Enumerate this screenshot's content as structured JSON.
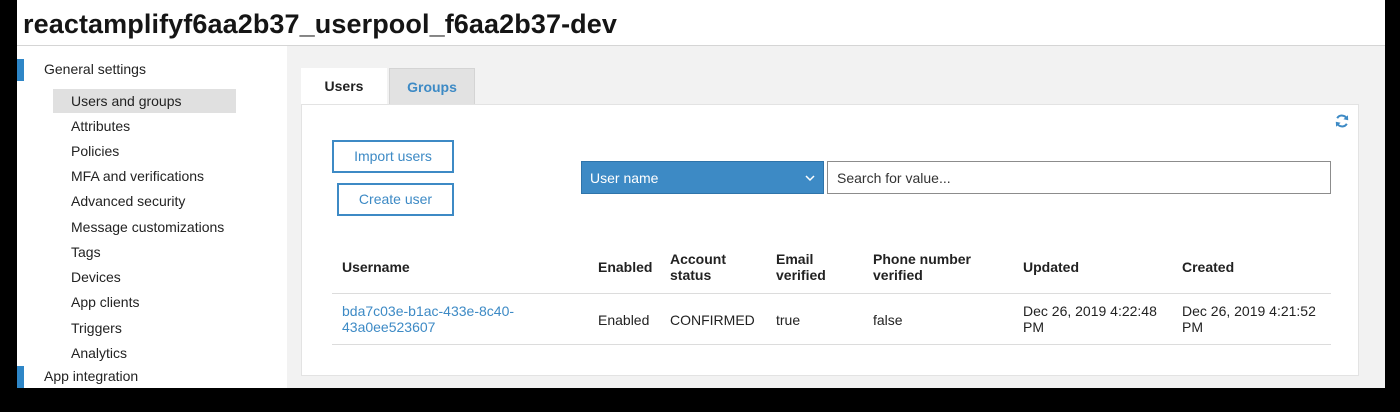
{
  "header": {
    "title": "reactamplifyf6aa2b37_userpool_f6aa2b37-dev"
  },
  "sidebar": {
    "sections": [
      {
        "label": "General settings"
      },
      {
        "label": "App integration"
      }
    ],
    "items": [
      {
        "label": "Users and groups",
        "active": true
      },
      {
        "label": "Attributes"
      },
      {
        "label": "Policies"
      },
      {
        "label": "MFA and verifications"
      },
      {
        "label": "Advanced security"
      },
      {
        "label": "Message customizations"
      },
      {
        "label": "Tags"
      },
      {
        "label": "Devices"
      },
      {
        "label": "App clients"
      },
      {
        "label": "Triggers"
      },
      {
        "label": "Analytics"
      }
    ]
  },
  "tabs": [
    {
      "label": "Users",
      "active": true
    },
    {
      "label": "Groups",
      "active": false
    }
  ],
  "actions": {
    "import_label": "Import users",
    "create_label": "Create user"
  },
  "search": {
    "attribute_selected": "User name",
    "placeholder": "Search for value..."
  },
  "table": {
    "headers": [
      "Username",
      "Enabled",
      "Account status",
      "Email verified",
      "Phone number verified",
      "Updated",
      "Created"
    ],
    "rows": [
      {
        "username": "bda7c03e-b1ac-433e-8c40-43a0ee523607",
        "enabled": "Enabled",
        "status": "CONFIRMED",
        "email_verified": "true",
        "phone_verified": "false",
        "updated": "Dec 26, 2019 4:22:48 PM",
        "created": "Dec 26, 2019 4:21:52 PM"
      }
    ]
  },
  "icons": {
    "refresh": "refresh-icon",
    "select_chevron": "chevron-down-icon"
  },
  "colors": {
    "accent": "#3d8ac5",
    "sidebar_marker": "#2e86c7",
    "active_item_bg": "#e0e0e0"
  }
}
